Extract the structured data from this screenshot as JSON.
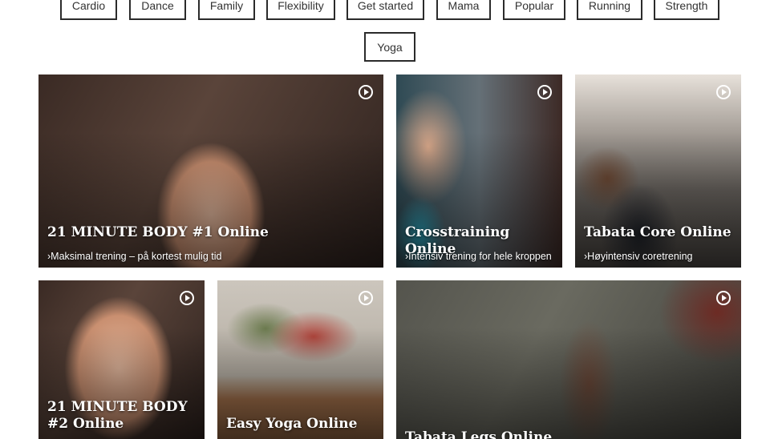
{
  "tags": [
    "Cardio",
    "Dance",
    "Family",
    "Flexibility",
    "Get started",
    "Mama",
    "Popular",
    "Running",
    "Strength",
    "Yoga"
  ],
  "workouts": [
    {
      "title": "21 MINUTE BODY #1 Online",
      "subtitle": "›Maksimal trening – på kortest mulig tid",
      "play_icon": "play-circle-icon"
    },
    {
      "title": "Crosstraining Online",
      "subtitle": "›Intensiv trening for hele kroppen",
      "play_icon": "play-circle-icon"
    },
    {
      "title": "Tabata Core Online",
      "subtitle": "›Høyintensiv coretrening",
      "play_icon": "play-circle-icon"
    },
    {
      "title": "21 MINUTE BODY #2 Online",
      "subtitle": "",
      "play_icon": "play-circle-icon"
    },
    {
      "title": "Easy Yoga Online",
      "subtitle": "",
      "play_icon": "play-circle-icon"
    },
    {
      "title": "Tabata Legs Online",
      "subtitle": "",
      "play_icon": "play-circle-icon"
    }
  ]
}
